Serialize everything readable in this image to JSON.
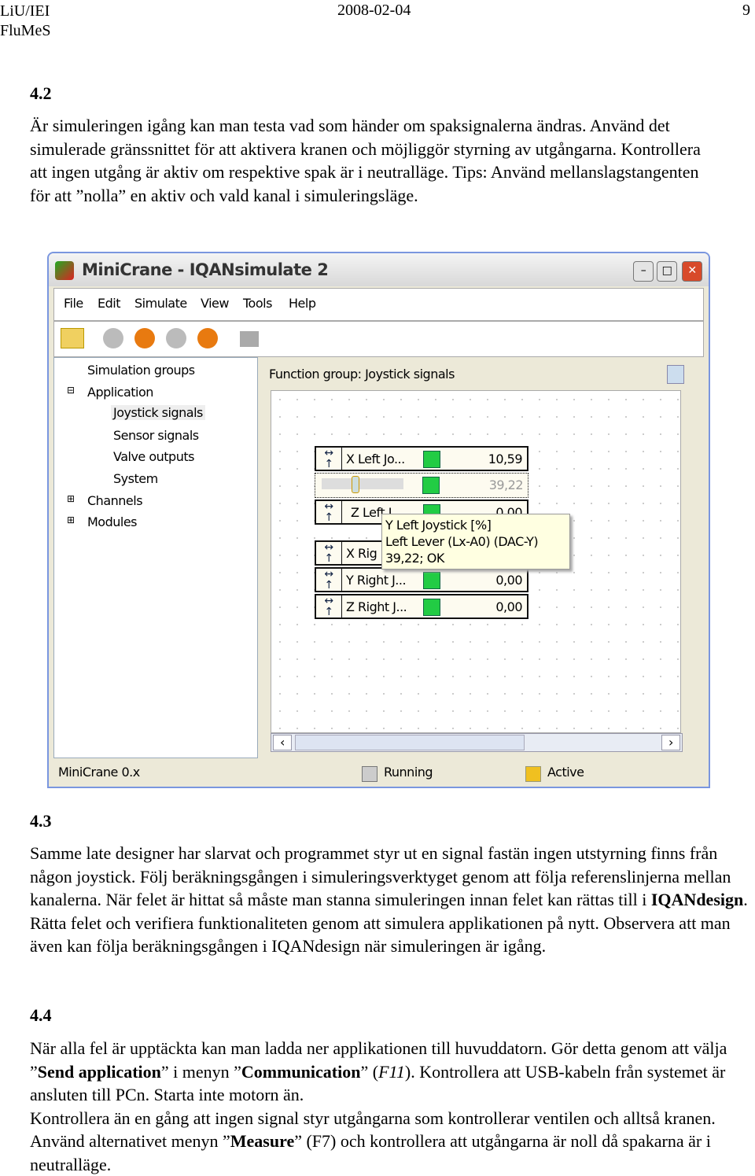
{
  "header": {
    "left1": "LiU/IEI",
    "left2": "FluMeS",
    "date": "2008-02-04",
    "page": "9"
  },
  "s42": {
    "heading": "4.2",
    "body": "Är simuleringen igång kan man testa vad som händer om spaksignalerna ändras. Använd det simulerade gränssnittet för att aktivera kranen och möjliggör styrning av utgångarna. Kontrollera att ingen utgång är aktiv om respektive spak är i neutralläge. Tips: Använd mellanslagstangenten för att ”nolla” en aktiv och vald kanal i simuleringsläge."
  },
  "app": {
    "title": "MiniCrane - IQANsimulate 2",
    "menu": [
      "File",
      "Edit",
      "Simulate",
      "View",
      "Tools",
      "Help"
    ],
    "tree": [
      "Simulation groups",
      "Application",
      "Joystick signals",
      "Sensor signals",
      "Valve outputs",
      "System",
      "Channels",
      "Modules"
    ],
    "function_group": "Function group: Joystick signals",
    "rows": [
      {
        "label": "X Left Jo...",
        "value": "10,59"
      },
      {
        "label": "",
        "value": "39,22"
      },
      {
        "label": "Z Left J...",
        "value": "0.00"
      },
      {
        "label": "X Rig",
        "value": ""
      },
      {
        "label": "Y Right J...",
        "value": "0,00"
      },
      {
        "label": "Z Right J...",
        "value": "0,00"
      }
    ],
    "slider_value": 39.22,
    "tooltip": [
      "Y Left Joystick [%]",
      "Left Lever (Lx-A0) (DAC-Y)",
      "39,22; OK"
    ],
    "status": {
      "app": "MiniCrane 0.x",
      "running": "Running",
      "active": "Active"
    },
    "colors": {
      "led": "#22cc44",
      "active": "#f0c020",
      "orange_btn": "#e87a10"
    }
  },
  "s43": {
    "heading": "4.3",
    "pre": "Samme late designer har slarvat och programmet styr ut en signal fastän ingen utstyrning finns från någon joystick. Följ beräkningsgången i simuleringsverktyget genom att följa referenslinjerna mellan kanalerna. När felet är hittat så måste man stanna simuleringen innan felet kan rättas till i ",
    "bold": "IQANdesign",
    "post": ". Rätta felet och verifiera funktionaliteten genom att simulera applikationen på nytt. Observera att man även kan följa beräkningsgången i IQANdesign när simuleringen är igång."
  },
  "s44": {
    "heading": "4.4",
    "p1": "När alla fel är upptäckta kan man ladda ner applikationen till huvuddatorn. Gör detta genom att välja ”",
    "b1": "Send application",
    "p2": "” i menyn ”",
    "b2": "Communication",
    "p3": "” (",
    "i1": "F11",
    "p4": "). Kontrollera att USB-kabeln från systemet är ansluten till PCn. Starta inte motorn än.",
    "p5": "Kontrollera än en gång att ingen signal styr utgångarna som kontrollerar ventilen och alltså kranen. Använd alternativet menyn ”",
    "b3": "Measure",
    "p6": "” (F7) och kontrollera att utgångarna är noll då spakarna är i neutralläge."
  }
}
